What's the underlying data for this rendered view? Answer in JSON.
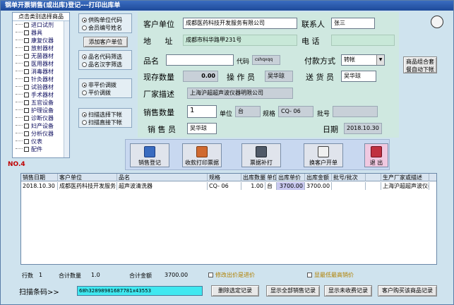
{
  "window": {
    "title": "钢单开票销售(或出库)登记---打印出库单"
  },
  "tree": {
    "header": "点击类别选择商品",
    "items": [
      "进口试剂",
      "器具",
      "康复仪器",
      "放射器材",
      "无菌器材",
      "医用器材",
      "消毒器材",
      "针灸器材",
      "试验器材",
      "手术器材",
      "五官设备",
      "护理设备",
      "诊断仪器",
      "妇产设备",
      "分析仪器",
      "仪表",
      "配件"
    ],
    "record_no": "NO.4"
  },
  "left_options": {
    "group1": [
      "供购单位代码",
      "会员编号姓名"
    ],
    "add_customer_button": "添加客户单位",
    "group2": [
      "品名代码筛选",
      "品名汉字筛选"
    ],
    "group3": [
      "非平价调拨",
      "平价调拨"
    ],
    "group4": [
      "扫描选择下帐",
      "扫描直接下帐"
    ]
  },
  "form": {
    "customer_label": "客户单位",
    "customer_value": "成都医药科技开发服务有限公司",
    "contact_label": "联系人",
    "contact_value": "张三",
    "address_label": "地  址",
    "address_value": "成都市科华路甲231号",
    "phone_label": "电 话",
    "phone_value": "",
    "product_label": "品名",
    "product_value": "",
    "code_label": "代码",
    "code_value": "cshqxqq",
    "payment_label": "付款方式",
    "payment_value": "转帐",
    "stock_label": "现存数量",
    "stock_value": "0.00",
    "operator_label": "操 作 员",
    "operator_value": "吴华琼",
    "delivery_label": "送 货 员",
    "delivery_value": "吴华琼",
    "maker_label": "厂家描述",
    "maker_value": "上海沪超超声波仪器明限公司",
    "qty_label": "销售数量",
    "qty_value": "1",
    "unit_label": "单位",
    "unit_value": "台",
    "spec_label": "规格",
    "spec_value": "CQ- 06",
    "batch_label": "批号",
    "batch_value": "",
    "seller_label": "销 售 员",
    "seller_value": "吴华琼",
    "date_label": "日期",
    "date_value": "2018.10.30"
  },
  "side_button": "商品组合套餐自动下帐",
  "toolbar": [
    {
      "label": "销售登记",
      "icon": "register-icon"
    },
    {
      "label": "收款打印票据",
      "icon": "print-receipt-icon"
    },
    {
      "label": "票据补打",
      "icon": "reprint-icon"
    },
    {
      "label": "换客户开单",
      "icon": "switch-customer-icon"
    },
    {
      "label": "退 出",
      "icon": "exit-icon"
    }
  ],
  "grid": {
    "headers": [
      "销售日期",
      "客户单位",
      "品名",
      "规格",
      "出库数量",
      "单位",
      "出库单价",
      "出库金额",
      "批号/批次",
      "",
      "生产厂家或描述"
    ],
    "rows": [
      [
        "2018.10.30",
        "成都医药科技开发服务",
        "超声波清洗器",
        "CQ- 06",
        "1.00",
        "台",
        "3700.00",
        "3700.00",
        "",
        "",
        "上海沪超超声波仪器"
      ]
    ]
  },
  "footer": {
    "rows_label": "行数",
    "rows_value": "1",
    "qty_label": "合计数量",
    "qty_value": "1.0",
    "amount_label": "合计金额",
    "amount_value": "3700.00",
    "check1": "修改出价是进价",
    "check2": "显最低最高销价"
  },
  "scan": {
    "label": "扫描条码>>",
    "value": "68h32898981687781x43553"
  },
  "bottom_buttons": [
    "删除选定记录",
    "显示全部销售记录",
    "显示未收费记录",
    "客户购买该商品记录"
  ]
}
